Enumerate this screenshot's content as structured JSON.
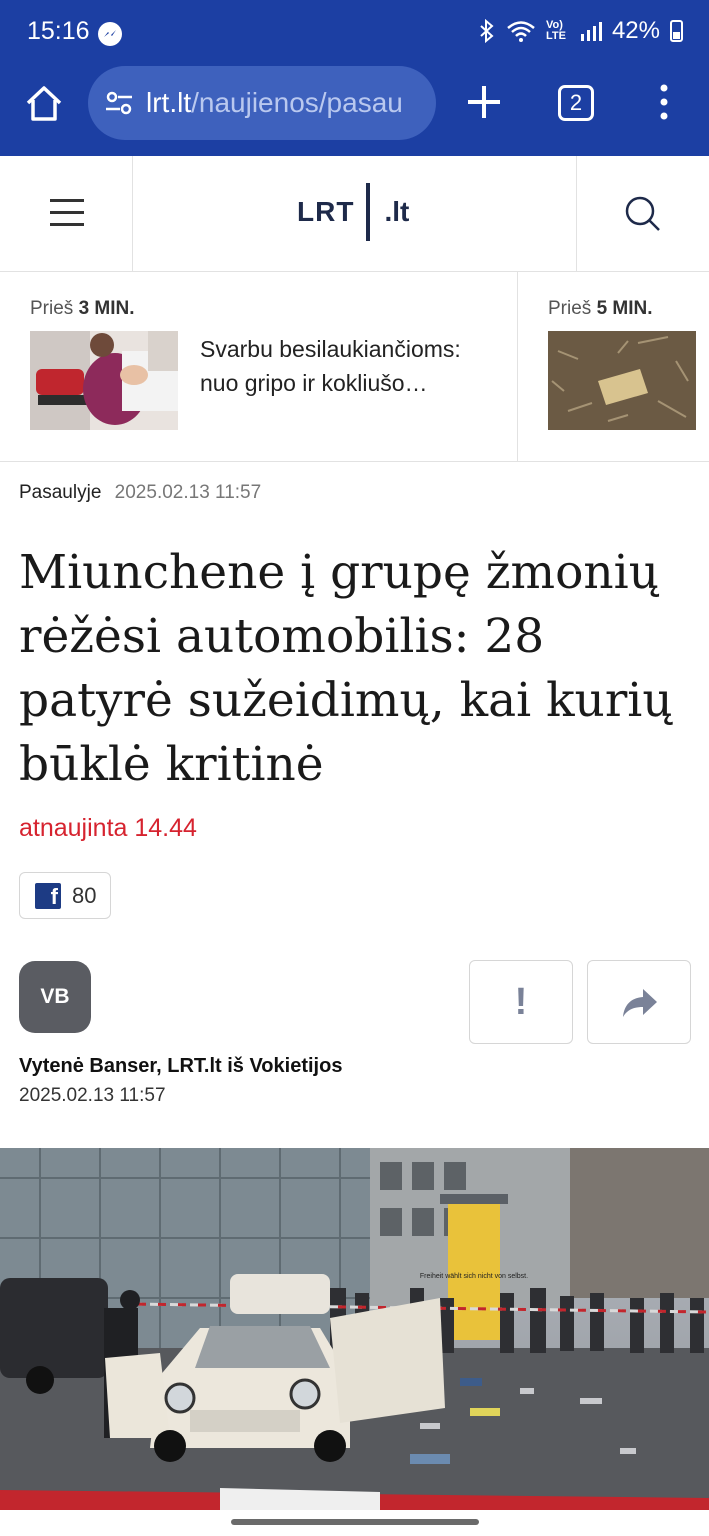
{
  "status_bar": {
    "time": "15:16",
    "network_label": "Vo) LTE",
    "battery": "42%",
    "icons": [
      "messenger-icon",
      "bluetooth-icon",
      "wifi-icon",
      "signal-icon",
      "battery-icon"
    ]
  },
  "browser": {
    "url_host": "lrt.lt",
    "url_path": "/naujienos/pasau",
    "tab_count": "2"
  },
  "site": {
    "logo_left": "LRT",
    "logo_right": ".lt"
  },
  "ticker": [
    {
      "time_prefix": "Prieš",
      "time_value": "3 MIN.",
      "title": "Svarbu besilaukiančioms: nuo gripo ir kokliušo…"
    },
    {
      "time_prefix": "Prieš",
      "time_value": "5 MIN.",
      "title": ""
    }
  ],
  "article": {
    "category": "Pasaulyje",
    "date": "2025.02.13 11:57",
    "headline": "Miunchene į grupę žmonių rėžėsi automobilis: 28 patyrė sužeidimų, kai kurių būklė kritinė",
    "updated": "atnaujinta 14.44",
    "fb_count": "80",
    "author_initials": "VB",
    "author": "Vytenė Banser, LRT.lt iš Vokietijos",
    "author_date": "2025.02.13 11:57",
    "report_glyph": "!",
    "hero_poster_text": "Freiheit wählt sich nicht von selbst."
  },
  "colors": {
    "browser_blue": "#1c3fa3",
    "url_box": "#3e61bd",
    "accent_red": "#d6232f",
    "logo_navy": "#1e2a4a"
  }
}
